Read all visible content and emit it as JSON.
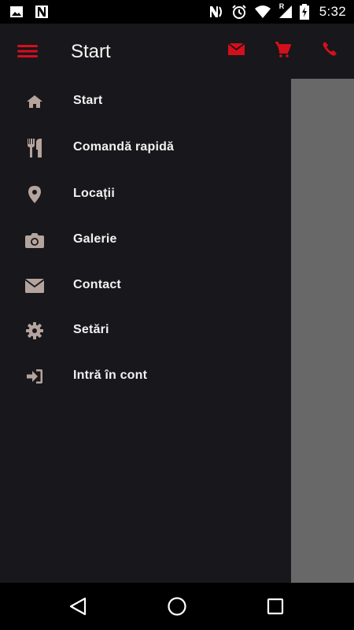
{
  "status_bar": {
    "time": "5:32",
    "network_badge": "R",
    "icons": [
      "image-icon",
      "n-app-icon",
      "nfc-icon",
      "vibrate-icon",
      "alarm-icon",
      "wifi-icon",
      "signal-icon",
      "battery-charging-icon"
    ]
  },
  "app_bar": {
    "title": "Start",
    "actions": [
      "mail-icon",
      "cart-icon",
      "phone-icon"
    ]
  },
  "colors": {
    "accent": "#d40f1c",
    "drawer_bg": "#18171b",
    "icon": "#b4a49d",
    "scrim": "#686868"
  },
  "drawer": {
    "items": [
      {
        "label": "Start",
        "icon": "home-icon"
      },
      {
        "label": "Comandă rapidă",
        "icon": "cutlery-icon"
      },
      {
        "label": "Locații",
        "icon": "location-pin-icon"
      },
      {
        "label": "Galerie",
        "icon": "camera-icon"
      },
      {
        "label": "Contact",
        "icon": "envelope-icon"
      },
      {
        "label": "Setări",
        "icon": "gear-icon"
      },
      {
        "label": "Intră în cont",
        "icon": "sign-in-icon"
      }
    ]
  },
  "nav_bar": {
    "buttons": [
      "back-icon",
      "home-circle-icon",
      "recents-icon"
    ]
  }
}
